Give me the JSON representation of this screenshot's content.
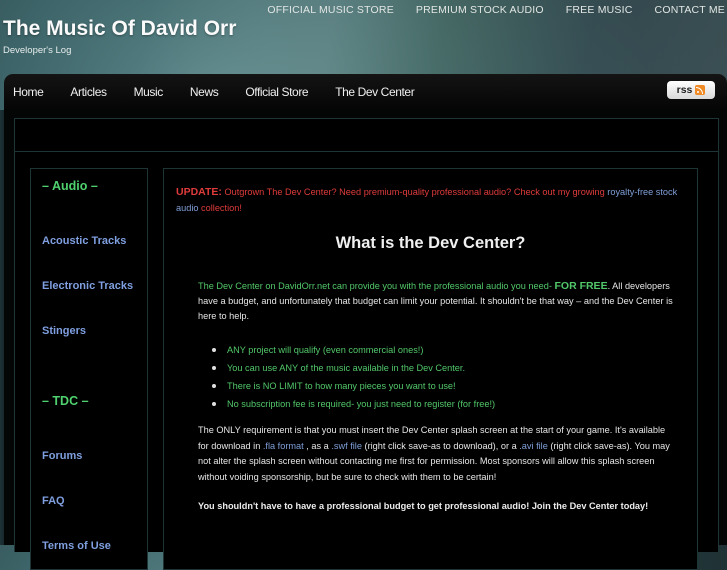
{
  "top_links": [
    "OFFICIAL MUSIC STORE",
    "PREMIUM STOCK AUDIO",
    "FREE MUSIC",
    "CONTACT ME"
  ],
  "site": {
    "title": "The Music Of David Orr",
    "tagline": "Developer's Log"
  },
  "nav": {
    "items": [
      "Home",
      "Articles",
      "Music",
      "News",
      "Official Store",
      "The Dev Center"
    ],
    "rss_label": "rss",
    "rss_icon": "rss-feed-icon"
  },
  "sidebar": {
    "sections": [
      {
        "heading": "– Audio –",
        "links": [
          "Acoustic Tracks",
          "Electronic Tracks",
          "Stingers"
        ]
      },
      {
        "heading": "– TDC –",
        "links": [
          "Forums",
          "FAQ",
          "Terms of Use"
        ]
      }
    ]
  },
  "main": {
    "update": {
      "label": "UPDATE:",
      "text": " Outgrown The Dev Center? Need premium-quality professional audio? Check out my growing ",
      "link": "royalty-free stock audio",
      "text_after": " collection!"
    },
    "title": "What is the Dev Center?",
    "intro": {
      "green_text": "The Dev Center on DavidOrr.net can provide you with the professional audio you need- ",
      "free": "FOR FREE",
      "rest": ". All developers have a budget, and unfortunately that budget can limit your potential. It shouldn't be that way – and the Dev Center is here to help."
    },
    "features": [
      "ANY project will qualify (even commercial ones!)",
      "You can use ANY of the music available in the Dev Center.",
      "There is NO LIMIT to how many pieces you want to use!",
      "No subscription fee is required- you just need to register (for free!)"
    ],
    "requirement": {
      "part1": "The ONLY requirement is that you must insert the Dev Center splash screen at the start of your game. It's available for download in ",
      "link_fla": ".fla format",
      "part2": " , as a ",
      "link_swf": ".swf file",
      "part3": " (right click save-as to download), or a ",
      "link_avi": ".avi file",
      "part4": " (right click save-as). You may not alter the splash screen without contacting me first for permission. Most sponsors will allow this splash screen without voiding sponsorship, but be sure to check with them to be certain!"
    },
    "cta": "You shouldn't have to have a professional budget to get professional audio! Join the Dev Center today!"
  },
  "colors": {
    "heading_green": "#4fd16f",
    "link_blue": "#7f9fe0",
    "update_red": "#e03b3b",
    "body_green": "#52c86a"
  }
}
